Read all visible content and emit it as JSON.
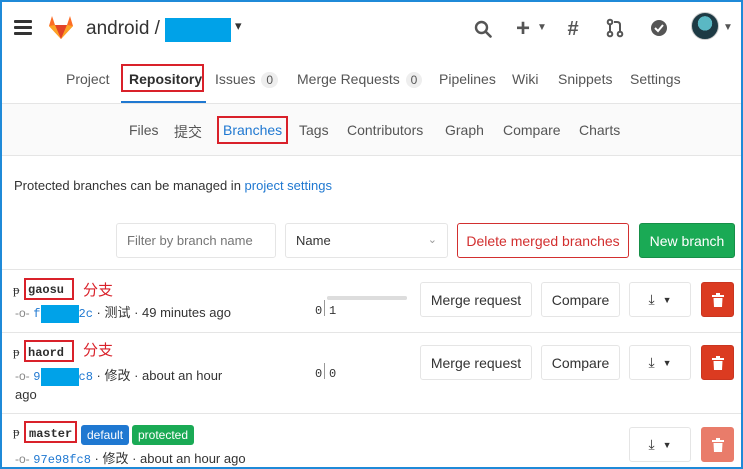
{
  "header": {
    "project_prefix": "android /",
    "caret": "▾",
    "search_icon": "search-icon",
    "plus_icon": "plus-icon",
    "hash_icon": "hash-icon",
    "merge_icon": "merge-icon",
    "todo_icon": "todo-check-icon"
  },
  "nav": {
    "tabs": [
      {
        "label": "Project"
      },
      {
        "label": "Repository"
      },
      {
        "label": "Issues",
        "count": "0"
      },
      {
        "label": "Merge Requests",
        "count": "0"
      },
      {
        "label": "Pipelines"
      },
      {
        "label": "Wiki"
      },
      {
        "label": "Snippets"
      },
      {
        "label": "Settings"
      }
    ]
  },
  "subnav": {
    "tabs": [
      {
        "label": "Files"
      },
      {
        "label": "提交"
      },
      {
        "label": "Branches"
      },
      {
        "label": "Tags"
      },
      {
        "label": "Contributors"
      },
      {
        "label": "Graph"
      },
      {
        "label": "Compare"
      },
      {
        "label": "Charts"
      }
    ]
  },
  "hint": {
    "text": "Protected branches can be managed in ",
    "link": "project settings"
  },
  "controls": {
    "filter_placeholder": "Filter by branch name",
    "sort_value": "Name",
    "delete_merged": "Delete merged branches",
    "new_branch": "New branch"
  },
  "branches": [
    {
      "name": "gaosu",
      "annotation": "分支",
      "sha_start": "f",
      "sha_end": "2c",
      "message": "· 测试 · 49 minutes ago",
      "behind": "0",
      "ahead": "1",
      "ahead_fraction": 1.0,
      "merge_request": "Merge request",
      "compare": "Compare"
    },
    {
      "name": "haord",
      "annotation": "分支",
      "sha_start": "9",
      "sha_end": "c8",
      "message": "· 修改 · about an hour",
      "message_wrap": "ago",
      "behind": "0",
      "ahead": "0",
      "merge_request": "Merge request",
      "compare": "Compare"
    },
    {
      "name": "master",
      "badge_default": "default",
      "badge_protected": "protected",
      "sha": "97e98fc8",
      "message": "· 修改 · about an hour ago"
    }
  ],
  "colors": {
    "accent": "#1f78d1",
    "success": "#1aaa55",
    "danger": "#db3b21",
    "annotation": "#d9212a",
    "redaction": "#00a2e8"
  }
}
